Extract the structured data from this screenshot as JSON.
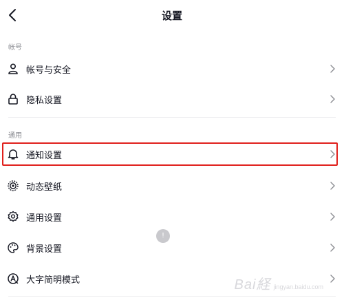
{
  "header": {
    "title": "设置"
  },
  "sections": {
    "account": {
      "label": "帐号"
    },
    "general": {
      "label": "通用"
    }
  },
  "rows": {
    "account_security": "帐号与安全",
    "privacy": "隐私设置",
    "notifications": "通知设置",
    "live_wallpaper": "动态壁纸",
    "general_settings": "通用设置",
    "background": "背景设置",
    "large_text": "大字简明模式"
  },
  "overlay": {
    "scroll_indicator": "!"
  },
  "watermark": {
    "brand": "Bai経",
    "sub": "jingyan.baidu.com"
  },
  "colors": {
    "highlight": "#e0201c",
    "text": "#161823",
    "muted": "#8a8b91"
  }
}
